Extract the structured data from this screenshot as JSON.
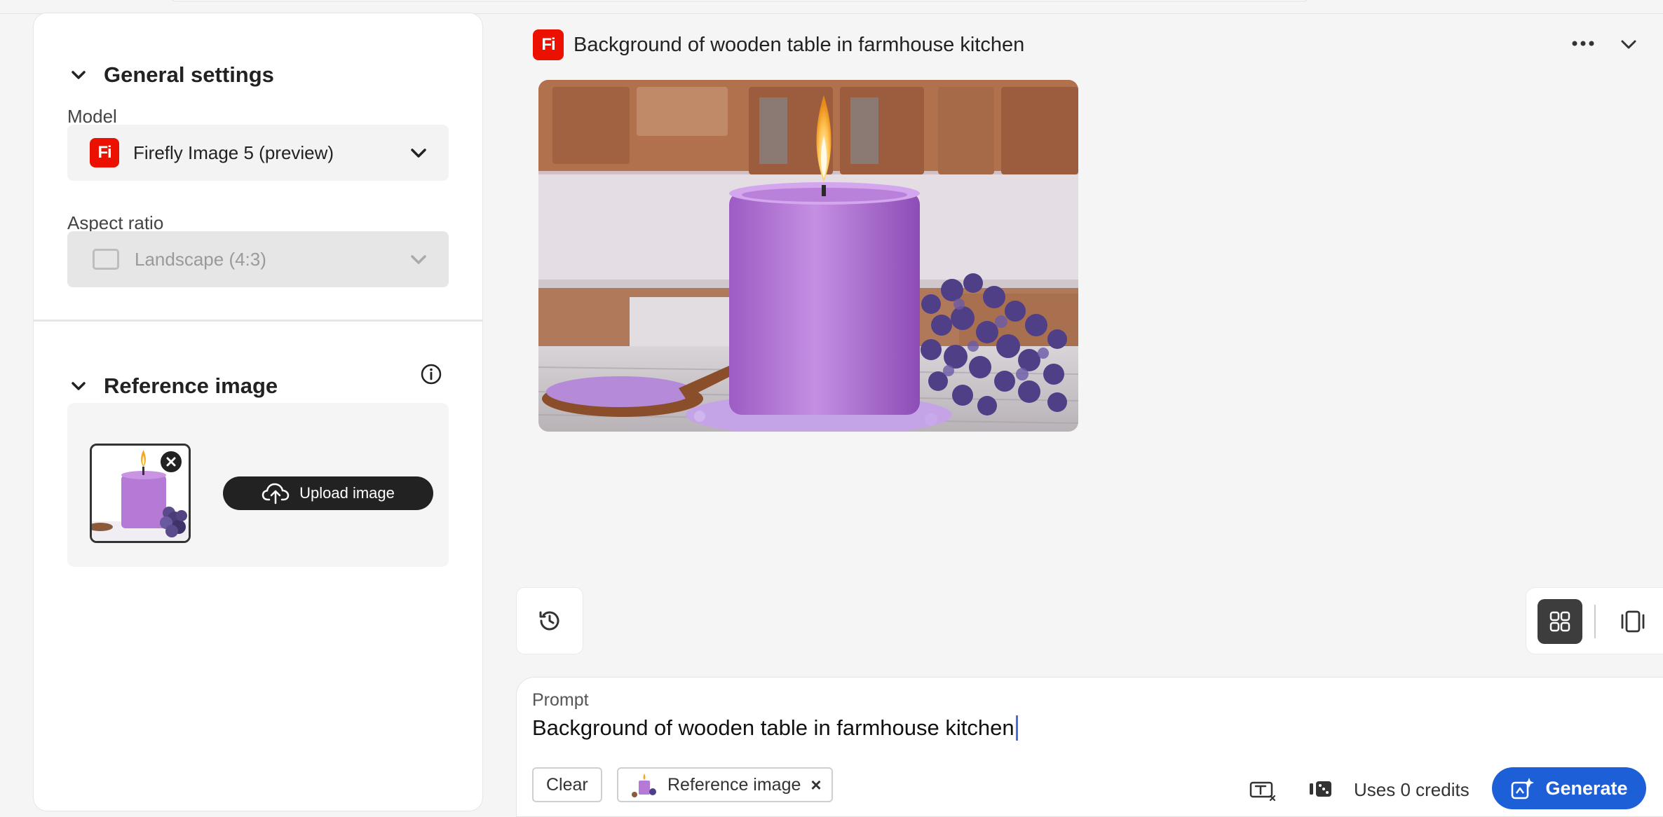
{
  "settings": {
    "general_title": "General settings",
    "model_label": "Model",
    "model_value": "Firefly Image 5 (preview)",
    "model_badge": "Fi",
    "aspect_label": "Aspect ratio",
    "aspect_value": "Landscape (4:3)"
  },
  "reference": {
    "title": "Reference image",
    "upload_label": "Upload image"
  },
  "document": {
    "badge": "Fi",
    "title": "Background of wooden table in farmhouse kitchen"
  },
  "prompt": {
    "label": "Prompt",
    "text": "Background of wooden table in farmhouse kitchen",
    "clear_label": "Clear",
    "reference_chip_label": "Reference image",
    "chip_close": "×",
    "credits_text": "Uses 0 credits",
    "generate_label": "Generate"
  },
  "colors": {
    "accent": "#1d5fd6",
    "brand": "#eb1000"
  }
}
